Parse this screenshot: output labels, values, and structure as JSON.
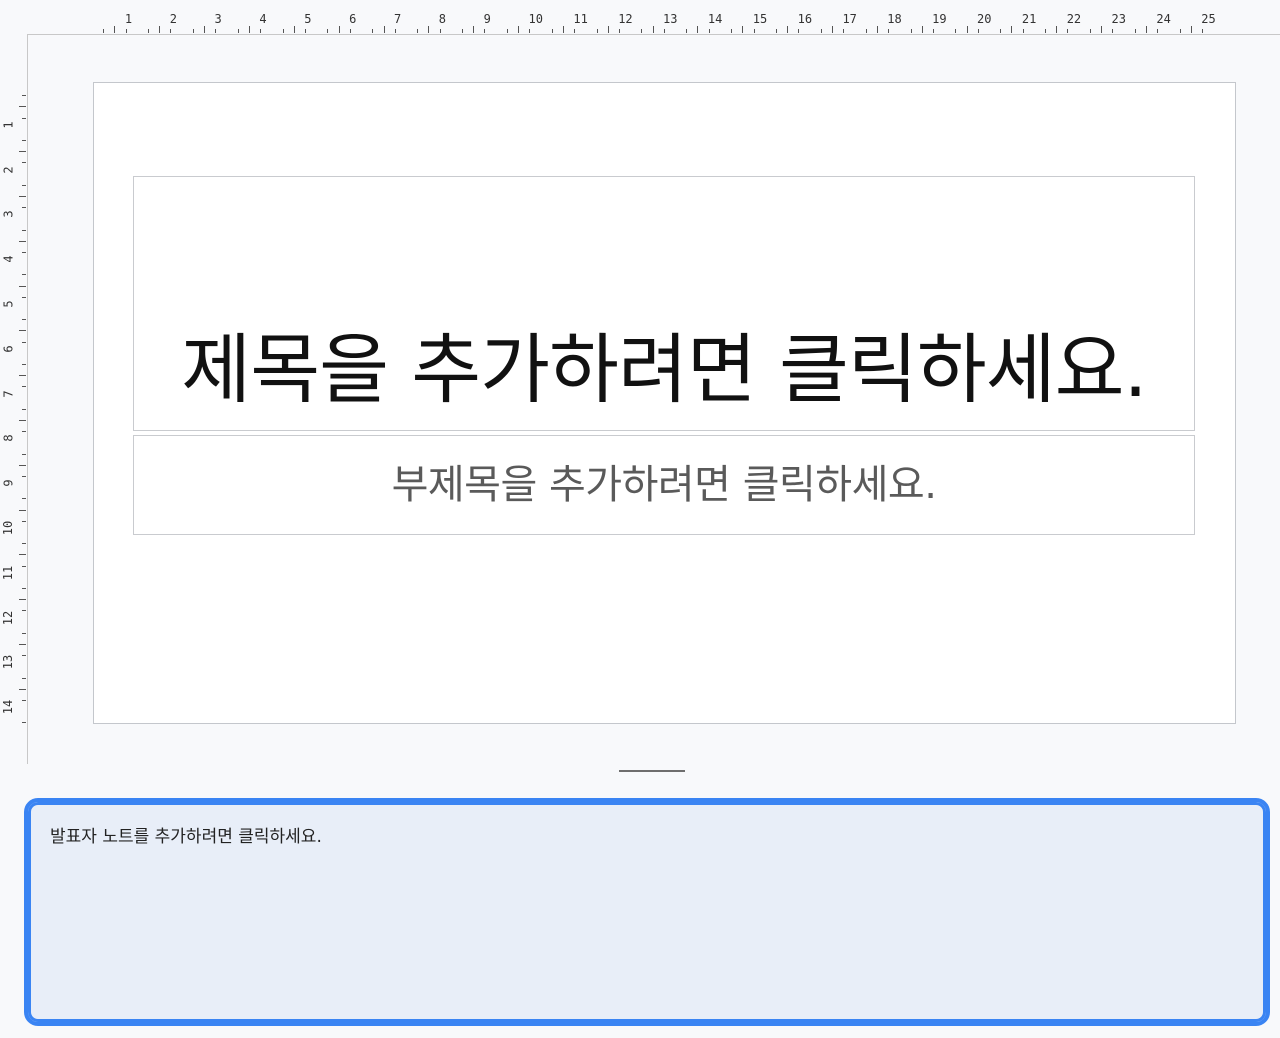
{
  "ruler": {
    "horizontal": [
      "1",
      "2",
      "3",
      "4",
      "5",
      "6",
      "7",
      "8",
      "9",
      "10",
      "11",
      "12",
      "13",
      "14",
      "15",
      "16",
      "17",
      "18",
      "19",
      "20",
      "21",
      "22",
      "23",
      "24",
      "25"
    ],
    "vertical": [
      "1",
      "2",
      "3",
      "4",
      "5",
      "6",
      "7",
      "8",
      "9",
      "10",
      "11",
      "12",
      "13",
      "14"
    ]
  },
  "slide": {
    "title_placeholder": "제목을 추가하려면 클릭하세요.",
    "subtitle_placeholder": "부제목을 추가하려면 클릭하세요."
  },
  "notes": {
    "placeholder": "발표자 노트를 추가하려면 클릭하세요."
  },
  "colors": {
    "accent": "#3a84f3",
    "notes_background": "#e8eef8",
    "canvas_background": "#f8f9fb"
  }
}
